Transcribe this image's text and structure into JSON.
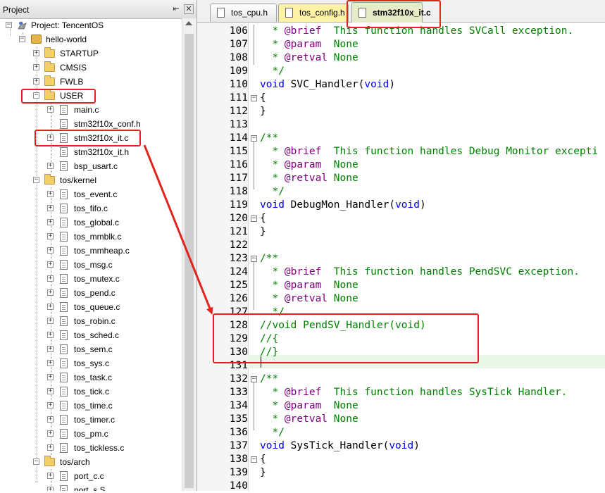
{
  "project_panel": {
    "title": "Project",
    "pin_glyph": "⇤",
    "close_glyph": "✕",
    "root_label": "Project: TencentOS",
    "target_label": "hello-world",
    "groups": [
      {
        "label": "STARTUP"
      },
      {
        "label": "CMSIS"
      },
      {
        "label": "FWLB"
      },
      {
        "label": "USER",
        "files": [
          "main.c",
          "stm32f10x_conf.h",
          "stm32f10x_it.c",
          "stm32f10x_it.h",
          "bsp_usart.c"
        ]
      },
      {
        "label": "tos/kernel",
        "files": [
          "tos_event.c",
          "tos_fifo.c",
          "tos_global.c",
          "tos_mmblk.c",
          "tos_mmheap.c",
          "tos_msg.c",
          "tos_mutex.c",
          "tos_pend.c",
          "tos_queue.c",
          "tos_robin.c",
          "tos_sched.c",
          "tos_sem.c",
          "tos_sys.c",
          "tos_task.c",
          "tos_tick.c",
          "tos_time.c",
          "tos_timer.c",
          "tos_pm.c",
          "tos_tickless.c"
        ]
      },
      {
        "label": "tos/arch",
        "files": [
          "port_c.c",
          "port_s.S"
        ]
      }
    ]
  },
  "editor": {
    "tabs": [
      {
        "label": "tos_cpu.h"
      },
      {
        "label": "tos_config.h"
      },
      {
        "label": "stm32f10x_it.c",
        "active": true
      }
    ],
    "lines": [
      {
        "n": "106",
        "text": "  * @brief  This function handles SVCall exception."
      },
      {
        "n": "107",
        "text": "  * @param  None"
      },
      {
        "n": "108",
        "text": "  * @retval None"
      },
      {
        "n": "109",
        "text": "  */"
      },
      {
        "n": "110",
        "text": "void SVC_Handler(void)"
      },
      {
        "n": "111",
        "text": "{"
      },
      {
        "n": "112",
        "text": "}"
      },
      {
        "n": "113",
        "text": ""
      },
      {
        "n": "114",
        "text": "/**"
      },
      {
        "n": "115",
        "text": "  * @brief  This function handles Debug Monitor excepti"
      },
      {
        "n": "116",
        "text": "  * @param  None"
      },
      {
        "n": "117",
        "text": "  * @retval None"
      },
      {
        "n": "118",
        "text": "  */"
      },
      {
        "n": "119",
        "text": "void DebugMon_Handler(void)"
      },
      {
        "n": "120",
        "text": "{"
      },
      {
        "n": "121",
        "text": "}"
      },
      {
        "n": "122",
        "text": ""
      },
      {
        "n": "123",
        "text": "/**"
      },
      {
        "n": "124",
        "text": "  * @brief  This function handles PendSVC exception."
      },
      {
        "n": "125",
        "text": "  * @param  None"
      },
      {
        "n": "126",
        "text": "  * @retval None"
      },
      {
        "n": "127",
        "text": "  */"
      },
      {
        "n": "128",
        "text": "//void PendSV_Handler(void)"
      },
      {
        "n": "129",
        "text": "//{"
      },
      {
        "n": "130",
        "text": "//}"
      },
      {
        "n": "131",
        "text": ""
      },
      {
        "n": "132",
        "text": "/**"
      },
      {
        "n": "133",
        "text": "  * @brief  This function handles SysTick Handler."
      },
      {
        "n": "134",
        "text": "  * @param  None"
      },
      {
        "n": "135",
        "text": "  * @retval None"
      },
      {
        "n": "136",
        "text": "  */"
      },
      {
        "n": "137",
        "text": "void SysTick_Handler(void)"
      },
      {
        "n": "138",
        "text": "{"
      },
      {
        "n": "139",
        "text": "}"
      },
      {
        "n": "140",
        "text": ""
      }
    ]
  },
  "colors": {
    "comment": "#008000",
    "keyword": "#0000ff",
    "doc_tag": "#800080",
    "annotation_red": "#e0231e",
    "active_tab": "#e6ecc8",
    "config_tab": "#fdf2a6"
  }
}
